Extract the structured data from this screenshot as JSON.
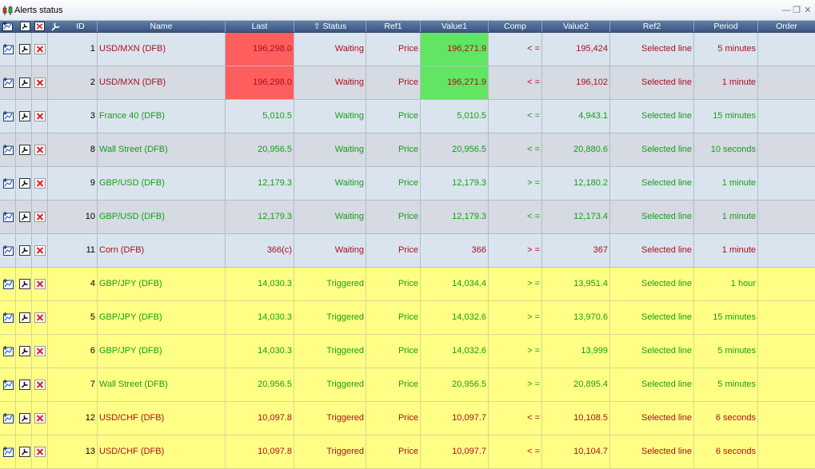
{
  "window": {
    "title": "Alerts status"
  },
  "columns": [
    "ID",
    "Name",
    "Last",
    "Status",
    "Ref1",
    "Value1",
    "Comp",
    "Value2",
    "Ref2",
    "Period",
    "Order"
  ],
  "colors": {
    "waiting_bg_odd": "#dae4ee",
    "waiting_bg_even": "#d5dae3",
    "triggered_bg": "#ffff85",
    "text_red": "#a8101e",
    "text_green": "#169e16",
    "highlight_red": "#ff5e5e",
    "highlight_green": "#62e562",
    "header_bg": "#4a6890"
  },
  "row_icons": [
    "open-chart-icon",
    "modify-alert-icon",
    "delete-alert-icon"
  ],
  "rows": [
    {
      "id": "1",
      "name": "USD/MXN (DFB)",
      "last": "196,298.0",
      "status": "Waiting",
      "ref1": "Price",
      "value1": "196,271.9",
      "comp": "< =",
      "value2": "195,424",
      "ref2": "Selected line",
      "period": "5 minutes",
      "order": "",
      "color": "red",
      "state": "waiting",
      "last_bg": "red",
      "value1_bg": "green"
    },
    {
      "id": "2",
      "name": "USD/MXN (DFB)",
      "last": "196,298.0",
      "status": "Waiting",
      "ref1": "Price",
      "value1": "196,271.9",
      "comp": "< =",
      "value2": "196,102",
      "ref2": "Selected line",
      "period": "1 minute",
      "order": "",
      "color": "red",
      "state": "waiting",
      "last_bg": "red",
      "value1_bg": "green"
    },
    {
      "id": "3",
      "name": "France 40 (DFB)",
      "last": "5,010.5",
      "status": "Waiting",
      "ref1": "Price",
      "value1": "5,010.5",
      "comp": "< =",
      "value2": "4,943.1",
      "ref2": "Selected line",
      "period": "15 minutes",
      "order": "",
      "color": "green",
      "state": "waiting"
    },
    {
      "id": "8",
      "name": "Wall Street (DFB)",
      "last": "20,956.5",
      "status": "Waiting",
      "ref1": "Price",
      "value1": "20,956.5",
      "comp": "< =",
      "value2": "20,880.6",
      "ref2": "Selected line",
      "period": "10 seconds",
      "order": "",
      "color": "green",
      "state": "waiting"
    },
    {
      "id": "9",
      "name": "GBP/USD (DFB)",
      "last": "12,179.3",
      "status": "Waiting",
      "ref1": "Price",
      "value1": "12,179.3",
      "comp": "> =",
      "value2": "12,180.2",
      "ref2": "Selected line",
      "period": "1 minute",
      "order": "",
      "color": "green",
      "state": "waiting"
    },
    {
      "id": "10",
      "name": "GBP/USD (DFB)",
      "last": "12,179.3",
      "status": "Waiting",
      "ref1": "Price",
      "value1": "12,179.3",
      "comp": "< =",
      "value2": "12,173.4",
      "ref2": "Selected line",
      "period": "1 minute",
      "order": "",
      "color": "green",
      "state": "waiting"
    },
    {
      "id": "11",
      "name": "Corn (DFB)",
      "last": "366(c)",
      "status": "Waiting",
      "ref1": "Price",
      "value1": "366",
      "comp": "> =",
      "value2": "367",
      "ref2": "Selected line",
      "period": "1 minute",
      "order": "",
      "color": "red",
      "state": "waiting"
    },
    {
      "id": "4",
      "name": "GBP/JPY (DFB)",
      "last": "14,030.3",
      "status": "Triggered",
      "ref1": "Price",
      "value1": "14,034.4",
      "comp": "> =",
      "value2": "13,951.4",
      "ref2": "Selected line",
      "period": "1 hour",
      "order": "",
      "color": "green",
      "state": "triggered"
    },
    {
      "id": "5",
      "name": "GBP/JPY (DFB)",
      "last": "14,030.3",
      "status": "Triggered",
      "ref1": "Price",
      "value1": "14,032.6",
      "comp": "> =",
      "value2": "13,970.6",
      "ref2": "Selected line",
      "period": "15 minutes",
      "order": "",
      "color": "green",
      "state": "triggered"
    },
    {
      "id": "6",
      "name": "GBP/JPY (DFB)",
      "last": "14,030.3",
      "status": "Triggered",
      "ref1": "Price",
      "value1": "14,032.6",
      "comp": "> =",
      "value2": "13,999",
      "ref2": "Selected line",
      "period": "5 minutes",
      "order": "",
      "color": "green",
      "state": "triggered"
    },
    {
      "id": "7",
      "name": "Wall Street (DFB)",
      "last": "20,956.5",
      "status": "Triggered",
      "ref1": "Price",
      "value1": "20,956.5",
      "comp": "> =",
      "value2": "20,895.4",
      "ref2": "Selected line",
      "period": "5 minutes",
      "order": "",
      "color": "green",
      "state": "triggered"
    },
    {
      "id": "12",
      "name": "USD/CHF (DFB)",
      "last": "10,097.8",
      "status": "Triggered",
      "ref1": "Price",
      "value1": "10,097.7",
      "comp": "< =",
      "value2": "10,108.5",
      "ref2": "Selected line",
      "period": "6 seconds",
      "order": "",
      "color": "red",
      "state": "triggered"
    },
    {
      "id": "13",
      "name": "USD/CHF (DFB)",
      "last": "10,097.8",
      "status": "Triggered",
      "ref1": "Price",
      "value1": "10,097.7",
      "comp": "< =",
      "value2": "10,104.7",
      "ref2": "Selected line",
      "period": "6 seconds",
      "order": "",
      "color": "red",
      "state": "triggered"
    }
  ]
}
